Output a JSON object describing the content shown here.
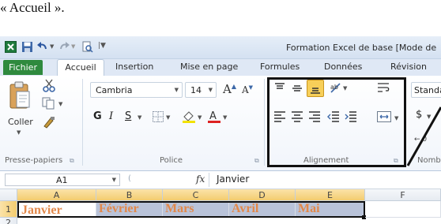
{
  "caption": "« Accueil ».",
  "window": {
    "title": "Formation Excel de base  [Mode de"
  },
  "tabs": [
    {
      "label": "Fichier"
    },
    {
      "label": "Accueil"
    },
    {
      "label": "Insertion"
    },
    {
      "label": "Mise en page"
    },
    {
      "label": "Formules"
    },
    {
      "label": "Données"
    },
    {
      "label": "Révision"
    }
  ],
  "clipboard": {
    "paste_label": "Coller",
    "group_label": "Presse-papiers"
  },
  "font": {
    "font_name": "Cambria",
    "font_size": "14",
    "bold": "G",
    "italic": "I",
    "underline": "S",
    "group_label": "Police"
  },
  "alignment": {
    "group_label": "Alignement"
  },
  "number": {
    "format": "Standa",
    "group_label": "Nomb",
    "currency": "$"
  },
  "formula_bar": {
    "cell_ref": "A1",
    "fx": "fx",
    "value": "Janvier"
  },
  "sheet": {
    "columns": [
      "A",
      "B",
      "C",
      "D",
      "E",
      "F"
    ],
    "rows": [
      "1",
      "2"
    ],
    "row1": [
      "Janvier",
      "Février",
      "Mars",
      "Avril",
      "Mai"
    ]
  },
  "colors": {
    "file_tab": "#2f8a3e",
    "cell_text": "#e2884a",
    "selection": "#b9c3d9",
    "highlight_button": "#f7cf59"
  }
}
